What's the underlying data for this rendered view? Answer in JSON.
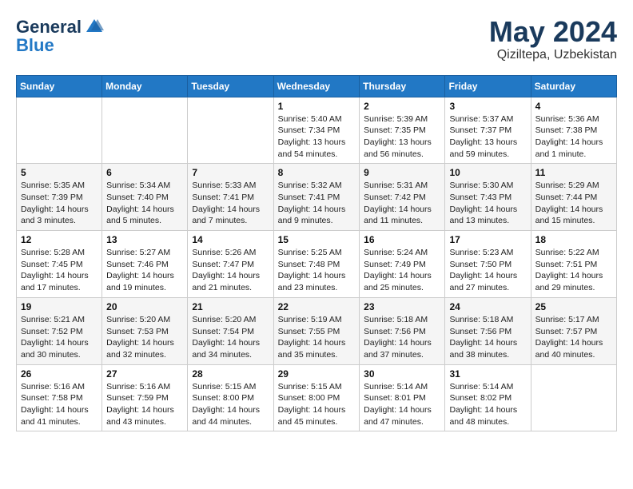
{
  "header": {
    "logo_general": "General",
    "logo_blue": "Blue",
    "month_year": "May 2024",
    "location": "Qiziltepa, Uzbekistan"
  },
  "days_of_week": [
    "Sunday",
    "Monday",
    "Tuesday",
    "Wednesday",
    "Thursday",
    "Friday",
    "Saturday"
  ],
  "weeks": [
    [
      null,
      null,
      null,
      {
        "day": "1",
        "sunrise": "5:40 AM",
        "sunset": "7:34 PM",
        "daylight": "13 hours and 54 minutes."
      },
      {
        "day": "2",
        "sunrise": "5:39 AM",
        "sunset": "7:35 PM",
        "daylight": "13 hours and 56 minutes."
      },
      {
        "day": "3",
        "sunrise": "5:37 AM",
        "sunset": "7:37 PM",
        "daylight": "13 hours and 59 minutes."
      },
      {
        "day": "4",
        "sunrise": "5:36 AM",
        "sunset": "7:38 PM",
        "daylight": "14 hours and 1 minute."
      }
    ],
    [
      {
        "day": "5",
        "sunrise": "5:35 AM",
        "sunset": "7:39 PM",
        "daylight": "14 hours and 3 minutes."
      },
      {
        "day": "6",
        "sunrise": "5:34 AM",
        "sunset": "7:40 PM",
        "daylight": "14 hours and 5 minutes."
      },
      {
        "day": "7",
        "sunrise": "5:33 AM",
        "sunset": "7:41 PM",
        "daylight": "14 hours and 7 minutes."
      },
      {
        "day": "8",
        "sunrise": "5:32 AM",
        "sunset": "7:41 PM",
        "daylight": "14 hours and 9 minutes."
      },
      {
        "day": "9",
        "sunrise": "5:31 AM",
        "sunset": "7:42 PM",
        "daylight": "14 hours and 11 minutes."
      },
      {
        "day": "10",
        "sunrise": "5:30 AM",
        "sunset": "7:43 PM",
        "daylight": "14 hours and 13 minutes."
      },
      {
        "day": "11",
        "sunrise": "5:29 AM",
        "sunset": "7:44 PM",
        "daylight": "14 hours and 15 minutes."
      }
    ],
    [
      {
        "day": "12",
        "sunrise": "5:28 AM",
        "sunset": "7:45 PM",
        "daylight": "14 hours and 17 minutes."
      },
      {
        "day": "13",
        "sunrise": "5:27 AM",
        "sunset": "7:46 PM",
        "daylight": "14 hours and 19 minutes."
      },
      {
        "day": "14",
        "sunrise": "5:26 AM",
        "sunset": "7:47 PM",
        "daylight": "14 hours and 21 minutes."
      },
      {
        "day": "15",
        "sunrise": "5:25 AM",
        "sunset": "7:48 PM",
        "daylight": "14 hours and 23 minutes."
      },
      {
        "day": "16",
        "sunrise": "5:24 AM",
        "sunset": "7:49 PM",
        "daylight": "14 hours and 25 minutes."
      },
      {
        "day": "17",
        "sunrise": "5:23 AM",
        "sunset": "7:50 PM",
        "daylight": "14 hours and 27 minutes."
      },
      {
        "day": "18",
        "sunrise": "5:22 AM",
        "sunset": "7:51 PM",
        "daylight": "14 hours and 29 minutes."
      }
    ],
    [
      {
        "day": "19",
        "sunrise": "5:21 AM",
        "sunset": "7:52 PM",
        "daylight": "14 hours and 30 minutes."
      },
      {
        "day": "20",
        "sunrise": "5:20 AM",
        "sunset": "7:53 PM",
        "daylight": "14 hours and 32 minutes."
      },
      {
        "day": "21",
        "sunrise": "5:20 AM",
        "sunset": "7:54 PM",
        "daylight": "14 hours and 34 minutes."
      },
      {
        "day": "22",
        "sunrise": "5:19 AM",
        "sunset": "7:55 PM",
        "daylight": "14 hours and 35 minutes."
      },
      {
        "day": "23",
        "sunrise": "5:18 AM",
        "sunset": "7:56 PM",
        "daylight": "14 hours and 37 minutes."
      },
      {
        "day": "24",
        "sunrise": "5:18 AM",
        "sunset": "7:56 PM",
        "daylight": "14 hours and 38 minutes."
      },
      {
        "day": "25",
        "sunrise": "5:17 AM",
        "sunset": "7:57 PM",
        "daylight": "14 hours and 40 minutes."
      }
    ],
    [
      {
        "day": "26",
        "sunrise": "5:16 AM",
        "sunset": "7:58 PM",
        "daylight": "14 hours and 41 minutes."
      },
      {
        "day": "27",
        "sunrise": "5:16 AM",
        "sunset": "7:59 PM",
        "daylight": "14 hours and 43 minutes."
      },
      {
        "day": "28",
        "sunrise": "5:15 AM",
        "sunset": "8:00 PM",
        "daylight": "14 hours and 44 minutes."
      },
      {
        "day": "29",
        "sunrise": "5:15 AM",
        "sunset": "8:00 PM",
        "daylight": "14 hours and 45 minutes."
      },
      {
        "day": "30",
        "sunrise": "5:14 AM",
        "sunset": "8:01 PM",
        "daylight": "14 hours and 47 minutes."
      },
      {
        "day": "31",
        "sunrise": "5:14 AM",
        "sunset": "8:02 PM",
        "daylight": "14 hours and 48 minutes."
      },
      null
    ]
  ]
}
